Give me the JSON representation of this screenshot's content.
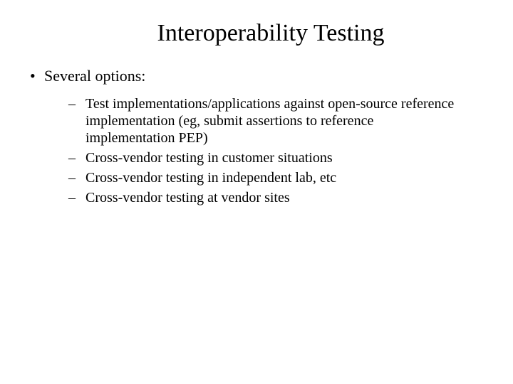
{
  "title": "Interoperability Testing",
  "level1": [
    {
      "text": "Several options:"
    }
  ],
  "level2": [
    {
      "text": "Test implementations/applications against open-source reference implementation (eg, submit assertions to reference implementation PEP)"
    },
    {
      "text": "Cross-vendor testing in customer situations"
    },
    {
      "text": "Cross-vendor testing in independent lab, etc"
    },
    {
      "text": "Cross-vendor testing at vendor sites"
    }
  ]
}
